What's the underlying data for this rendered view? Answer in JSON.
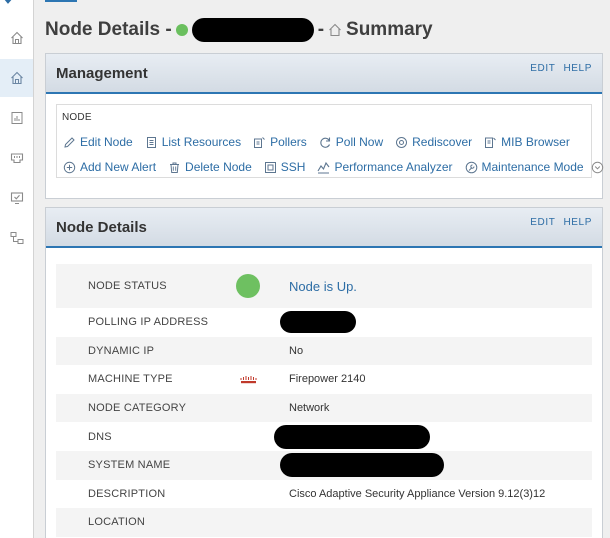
{
  "nav": {
    "items": [
      {
        "icon": "home-outline-icon"
      },
      {
        "icon": "home-icon",
        "active": true
      },
      {
        "icon": "report-icon"
      },
      {
        "icon": "network-port-icon"
      },
      {
        "icon": "monitor-check-icon"
      },
      {
        "icon": "topology-icon"
      }
    ]
  },
  "header": {
    "title_prefix": "Node Details -",
    "status_color": "#6abf5e",
    "node_name": "[redacted]",
    "separator": "-",
    "view_name": "Summary"
  },
  "management": {
    "title": "Management",
    "edit_label": "EDIT",
    "help_label": "HELP",
    "section_label": "NODE",
    "row1": [
      {
        "label": "Edit Node",
        "icon": "pencil-icon"
      },
      {
        "label": "List Resources",
        "icon": "list-document-icon"
      },
      {
        "label": "Pollers",
        "icon": "poller-icon"
      },
      {
        "label": "Poll Now",
        "icon": "refresh-icon"
      },
      {
        "label": "Rediscover",
        "icon": "rediscover-icon"
      },
      {
        "label": "MIB Browser",
        "icon": "mib-browser-icon"
      }
    ],
    "row2": [
      {
        "label": "Add New Alert",
        "icon": "plus-circle-icon"
      },
      {
        "label": "Delete Node",
        "icon": "trash-icon"
      },
      {
        "label": "SSH",
        "icon": "terminal-icon"
      },
      {
        "label": "Performance Analyzer",
        "icon": "performance-analyzer-icon"
      },
      {
        "label": "Maintenance Mode",
        "icon": "wrench-icon"
      }
    ]
  },
  "node_details": {
    "title": "Node Details",
    "edit_label": "EDIT",
    "help_label": "HELP",
    "rows": [
      {
        "label": "NODE STATUS",
        "value": "Node is Up."
      },
      {
        "label": "POLLING IP ADDRESS",
        "value": "[redacted]"
      },
      {
        "label": "DYNAMIC IP",
        "value": "No"
      },
      {
        "label": "MACHINE TYPE",
        "value": "Firepower 2140"
      },
      {
        "label": "NODE CATEGORY",
        "value": "Network"
      },
      {
        "label": "DNS",
        "value": "[redacted]"
      },
      {
        "label": "SYSTEM NAME",
        "value": "[redacted]"
      },
      {
        "label": "DESCRIPTION",
        "value": "Cisco Adaptive Security Appliance Version 9.12(3)12"
      },
      {
        "label": "LOCATION",
        "value": ""
      }
    ]
  }
}
